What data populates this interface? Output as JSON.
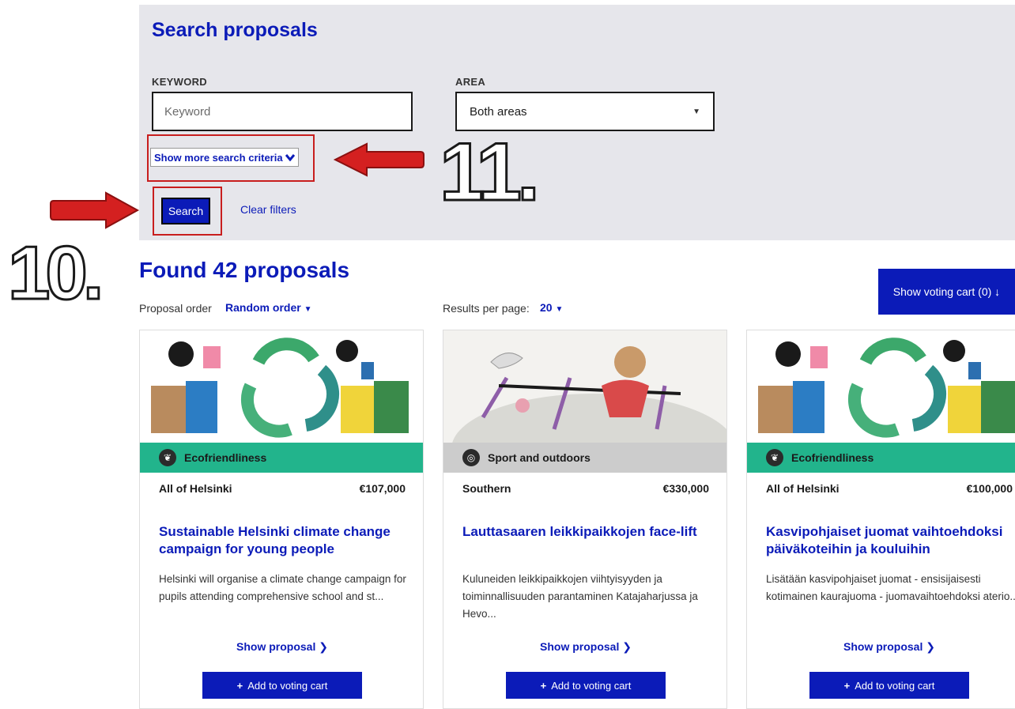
{
  "search": {
    "title": "Search proposals",
    "keyword_label": "KEYWORD",
    "keyword_placeholder": "Keyword",
    "area_label": "AREA",
    "area_value": "Both areas",
    "more_criteria": "Show more search criteria",
    "search_button": "Search",
    "clear_filters": "Clear filters"
  },
  "results": {
    "found": "Found 42 proposals",
    "order_label": "Proposal order",
    "order_value": "Random order",
    "per_page_label": "Results per page:",
    "per_page_value": "20",
    "voting_cart": "Show voting cart (0)"
  },
  "annotations": {
    "step10": "10.",
    "step11": "11."
  },
  "colors": {
    "accent": "#0b1bb8",
    "eco": "#22b48c",
    "sport": "#cccccc",
    "annotation": "#d42020"
  },
  "cards": [
    {
      "category": "Ecofriendliness",
      "area": "All of Helsinki",
      "amount": "€107,000",
      "title": "Sustainable Helsinki climate change campaign for young people",
      "description": "Helsinki will organise a climate change campaign for pupils attending comprehensive school and st...",
      "show": "Show proposal",
      "add": "Add to voting cart"
    },
    {
      "category": "Sport and outdoors",
      "area": "Southern",
      "amount": "€330,000",
      "title": "Lauttasaaren leikkipaikkojen face-lift",
      "description": "Kuluneiden leikkipaikkojen viihtyisyyden ja toiminnallisuuden parantaminen Katajaharjussa ja Hevo...",
      "show": "Show proposal",
      "add": "Add to voting cart"
    },
    {
      "category": "Ecofriendliness",
      "area": "All of Helsinki",
      "amount": "€100,000",
      "title": "Kasvipohjaiset juomat vaihtoehdoksi päiväkoteihin ja kouluihin",
      "description": "Lisätään kasvipohjaiset juomat - ensisijaisesti kotimainen kaurajuoma - juomavaihtoehdoksi aterio...",
      "show": "Show proposal",
      "add": "Add to voting cart"
    }
  ]
}
